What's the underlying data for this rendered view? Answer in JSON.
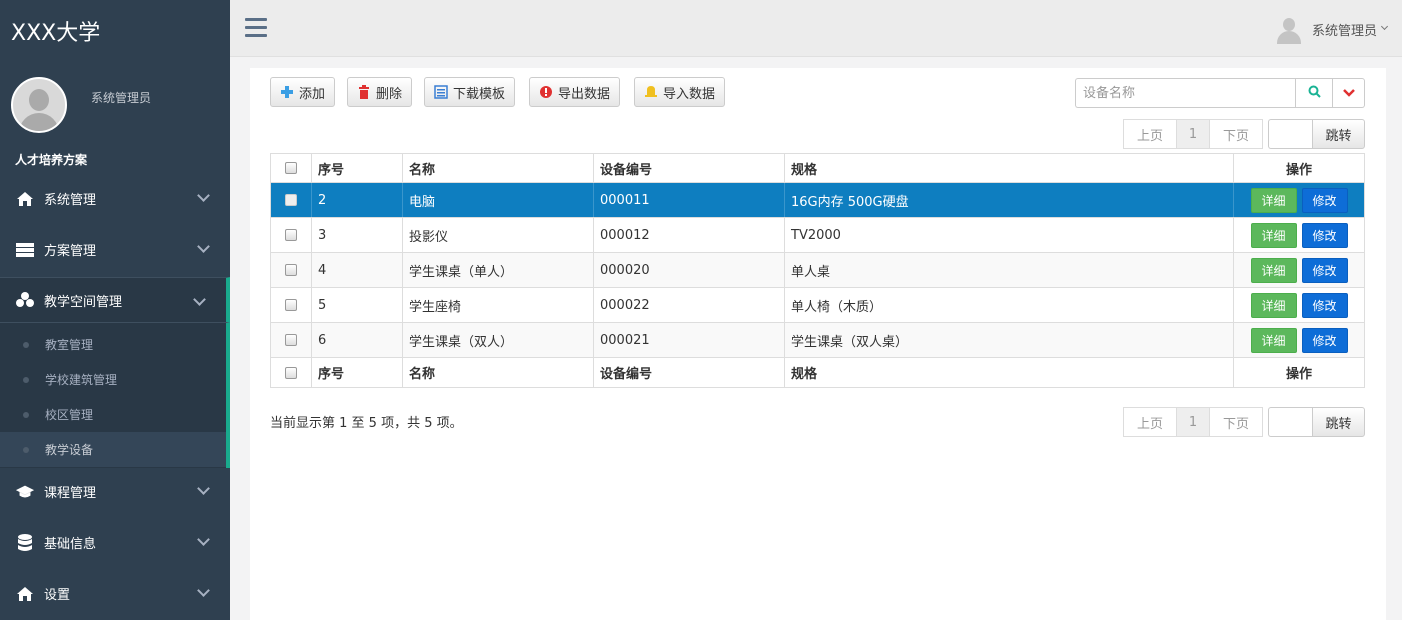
{
  "brand": "XXX大学",
  "profile": {
    "name": "系统管理员"
  },
  "section_title": "人才培养方案",
  "menu": [
    {
      "label": "系统管理",
      "icon": "home-icon"
    },
    {
      "label": "方案管理",
      "icon": "table-icon"
    },
    {
      "label": "教学空间管理",
      "icon": "cubes-icon"
    },
    {
      "label": "课程管理",
      "icon": "graduation-cap-icon"
    },
    {
      "label": "基础信息",
      "icon": "database-icon"
    },
    {
      "label": "设置",
      "icon": "home-icon"
    }
  ],
  "submenu": [
    {
      "label": "教室管理"
    },
    {
      "label": "学校建筑管理"
    },
    {
      "label": "校区管理"
    },
    {
      "label": "教学设备"
    }
  ],
  "topbar": {
    "user_name": "系统管理员"
  },
  "toolbar": {
    "add": "添加",
    "delete": "删除",
    "download_template": "下载模板",
    "export": "导出数据",
    "import": "导入数据"
  },
  "search": {
    "placeholder": "设备名称"
  },
  "pager": {
    "prev": "上页",
    "page": "1",
    "next": "下页",
    "jump": "跳转"
  },
  "table": {
    "columns": [
      "序号",
      "名称",
      "设备编号",
      "规格",
      "操作"
    ],
    "rows": [
      {
        "no": "2",
        "name": "电脑",
        "code": "000011",
        "spec": "16G内存 500G硬盘"
      },
      {
        "no": "3",
        "name": "投影仪",
        "code": "000012",
        "spec": "TV2000"
      },
      {
        "no": "4",
        "name": "学生课桌（单人）",
        "code": "000020",
        "spec": "单人桌"
      },
      {
        "no": "5",
        "name": "学生座椅",
        "code": "000022",
        "spec": "单人椅（木质）"
      },
      {
        "no": "6",
        "name": "学生课桌（双人）",
        "code": "000021",
        "spec": "学生课桌（双人桌）"
      }
    ],
    "detail_label": "详细",
    "edit_label": "修改"
  },
  "summary": "当前显示第 1 至 5 项，共 5 项。",
  "colors": {
    "sidebar": "#2f4050",
    "accent": "#19aa8d",
    "selected_row": "#0e7ec0",
    "detail": "#5cb85c",
    "edit": "#0e6dd7"
  }
}
